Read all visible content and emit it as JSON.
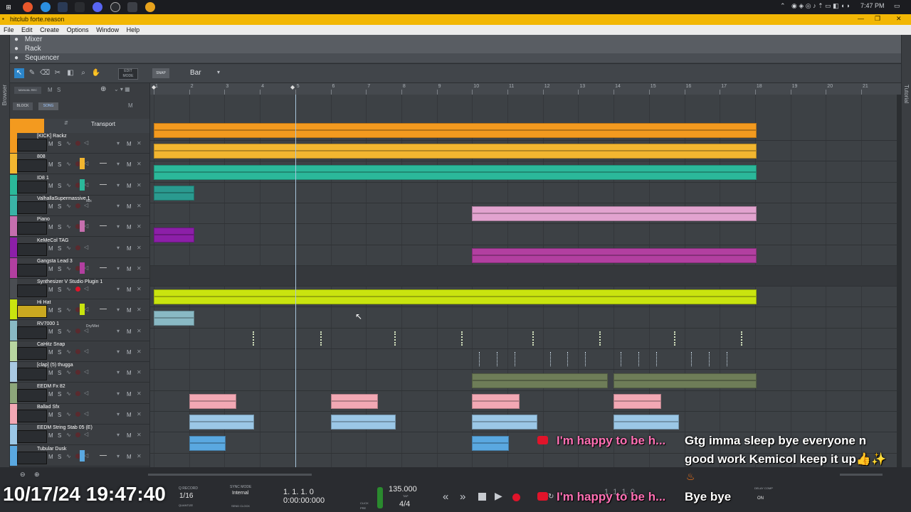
{
  "taskbar": {
    "clock": "7:47 PM",
    "icons": [
      "windows-start-icon",
      "firefox-icon",
      "chrome-icon",
      "edge-icon",
      "discord-icon",
      "obs-icon",
      "steam-icon",
      "reason-icon",
      "chrome2-icon"
    ]
  },
  "window": {
    "title": "hitclub forte.reason"
  },
  "menu": [
    "File",
    "Edit",
    "Create",
    "Options",
    "Window",
    "Help"
  ],
  "panels": {
    "mixer": "Mixer",
    "rack": "Rack",
    "sequencer": "Sequencer"
  },
  "side_labels": {
    "left": "Browser",
    "right": "Tutorial"
  },
  "toolbar": {
    "edit_mode": "EDIT MODE",
    "snap": "SNAP",
    "snap_value": "Bar",
    "manual_rec": "MANUAL REC",
    "block": "BLOCK",
    "song": "SONG",
    "m": "M",
    "s": "S"
  },
  "ruler": [
    "1",
    "2",
    "3",
    "4",
    "5",
    "6",
    "7",
    "8",
    "9",
    "10",
    "11",
    "12",
    "13",
    "14",
    "15",
    "16",
    "17",
    "18",
    "19",
    "20",
    "21"
  ],
  "transport_track": "Transport",
  "tracks": [
    {
      "name": "[KICK] Rackz",
      "color": "#f39a1f"
    },
    {
      "name": "808",
      "color": "#f2b630"
    },
    {
      "name": "ID8 1",
      "color": "#2bb89a"
    },
    {
      "name": "ValhallaSupermassive 1",
      "color": "#3ab3a6",
      "extra": "Mix"
    },
    {
      "name": "Piano",
      "color": "#c66fae"
    },
    {
      "name": "KeMeCol TAG",
      "color": "#8c1fa8"
    },
    {
      "name": "Gangsta Lead 3",
      "color": "#b23fa0"
    },
    {
      "name": "Synthesizer V Studio Plugin 1",
      "color": "#4a4d52"
    },
    {
      "name": "Hi Hat",
      "color": "#c9e40f"
    },
    {
      "name": "RV7000 1",
      "color": "#89b9c4",
      "extra": "Dry/Wet"
    },
    {
      "name": "CaHitz Snap",
      "color": "#b8d6a0"
    },
    {
      "name": "[clap] (5) thugga",
      "color": "#a9c9e2"
    },
    {
      "name": "EEDM Fx 82",
      "color": "#8da67a"
    },
    {
      "name": "Ballad Sfx",
      "color": "#f2a8b4"
    },
    {
      "name": "EEDM String Stab 05 (E)",
      "color": "#9bc7e6"
    },
    {
      "name": "Tubular Dusk",
      "color": "#5aa8e0"
    }
  ],
  "transport": {
    "q_record": "Q RECORD",
    "quantize": "1/16",
    "quantize_label": "QUANTIZE",
    "sync_mode": "SYNC MODE",
    "sync_value": "Internal",
    "send_clock": "SEND CLOCK",
    "position": "1. 1. 1. 0",
    "time": "0:00:00:000",
    "click": "CLICK",
    "pre": "PRE",
    "tempo": "135.000",
    "tap": "TAP",
    "signature": "4/4",
    "loop_pos": "1. 1. 1. 0",
    "delay_comp": "DELAY COMP",
    "delay_on": "ON"
  },
  "overlay": {
    "timestamp": "10/17/24 19:47:40",
    "chat1": "Gtg imma sleep bye everyone n",
    "chat2": "good work Kemicol keep it up👍✨",
    "chat_pink1": "I'm happy to be h...",
    "chat_pink2": "I'm happy to be h...",
    "bye": "Bye bye"
  },
  "colors": {
    "accent": "#f2b705",
    "background": "#2b2e31",
    "record": "#e0142a"
  }
}
